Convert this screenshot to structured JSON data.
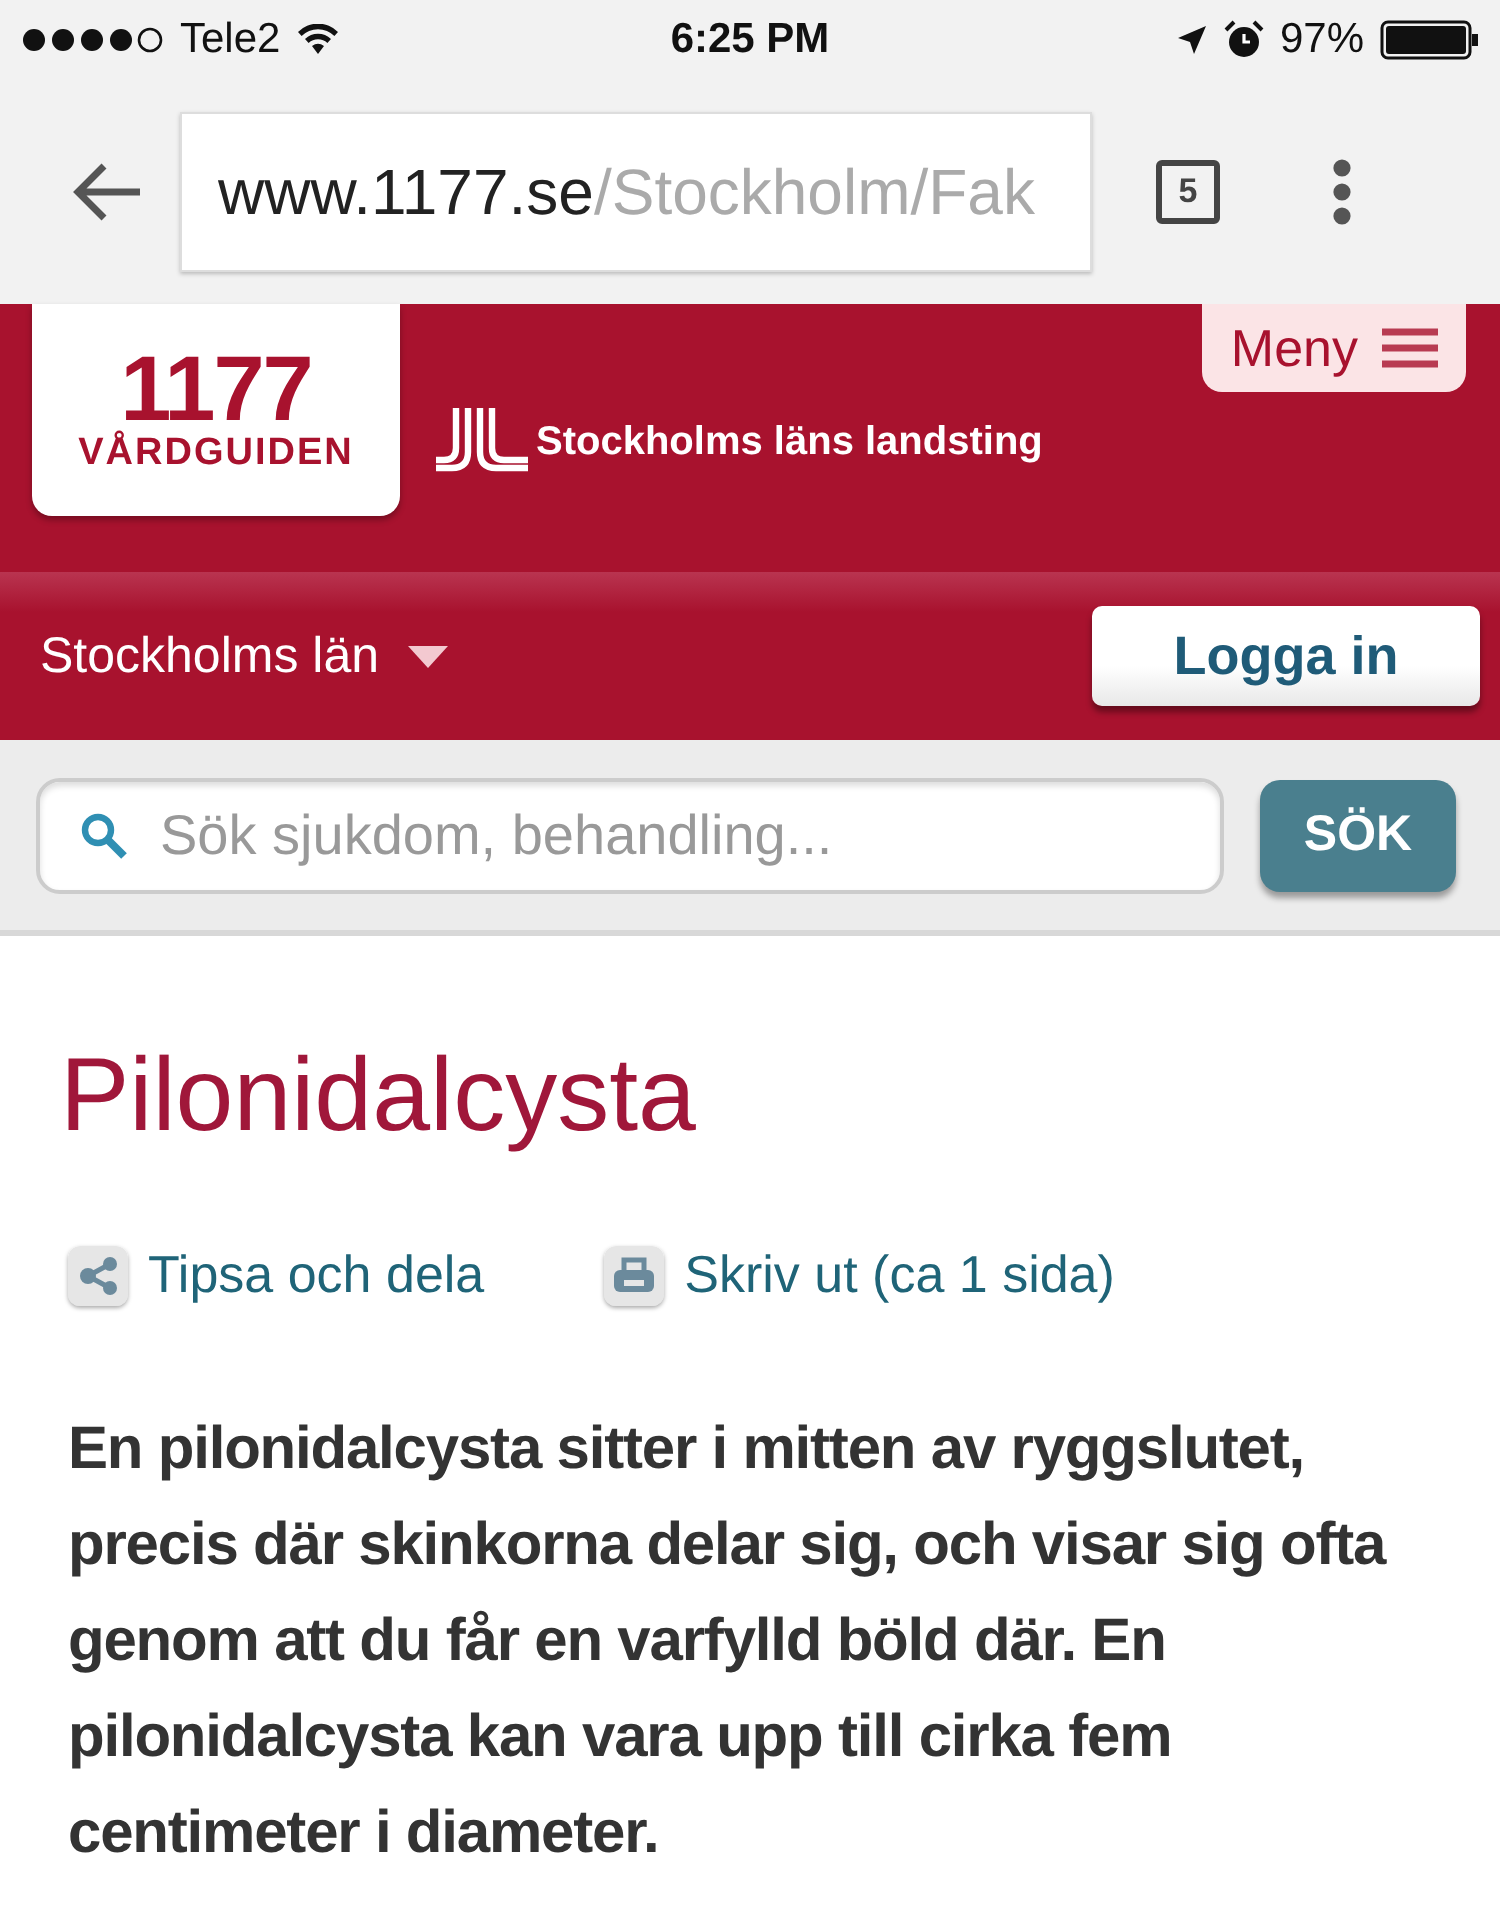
{
  "status_bar": {
    "carrier": "Tele2",
    "time": "6:25 PM",
    "battery": "97%"
  },
  "browser": {
    "url_host": "www.1177.se",
    "url_path": "/Stockholm/Fak",
    "tab_count": "5"
  },
  "header": {
    "logo_number": "1177",
    "logo_name": "VÅRDGUIDEN",
    "org_name": "Stockholms läns landsting",
    "menu_label": "Meny"
  },
  "region_bar": {
    "region": "Stockholms län",
    "login_label": "Logga in"
  },
  "search": {
    "placeholder": "Sök sjukdom, behandling...",
    "button": "SÖK"
  },
  "article": {
    "title": "Pilonidalcysta",
    "actions": [
      {
        "kind": "share",
        "label": "Tipsa och dela"
      },
      {
        "kind": "print",
        "label": "Skriv ut (ca 1 sida)"
      }
    ],
    "intro": "En pilonidalcysta sitter i mitten av ryggslutet, precis där skinkorna delar sig, och visar sig ofta genom att du får en varfylld böld där. En pilonidalcysta kan vara upp till cirka fem centimeter i diameter."
  }
}
